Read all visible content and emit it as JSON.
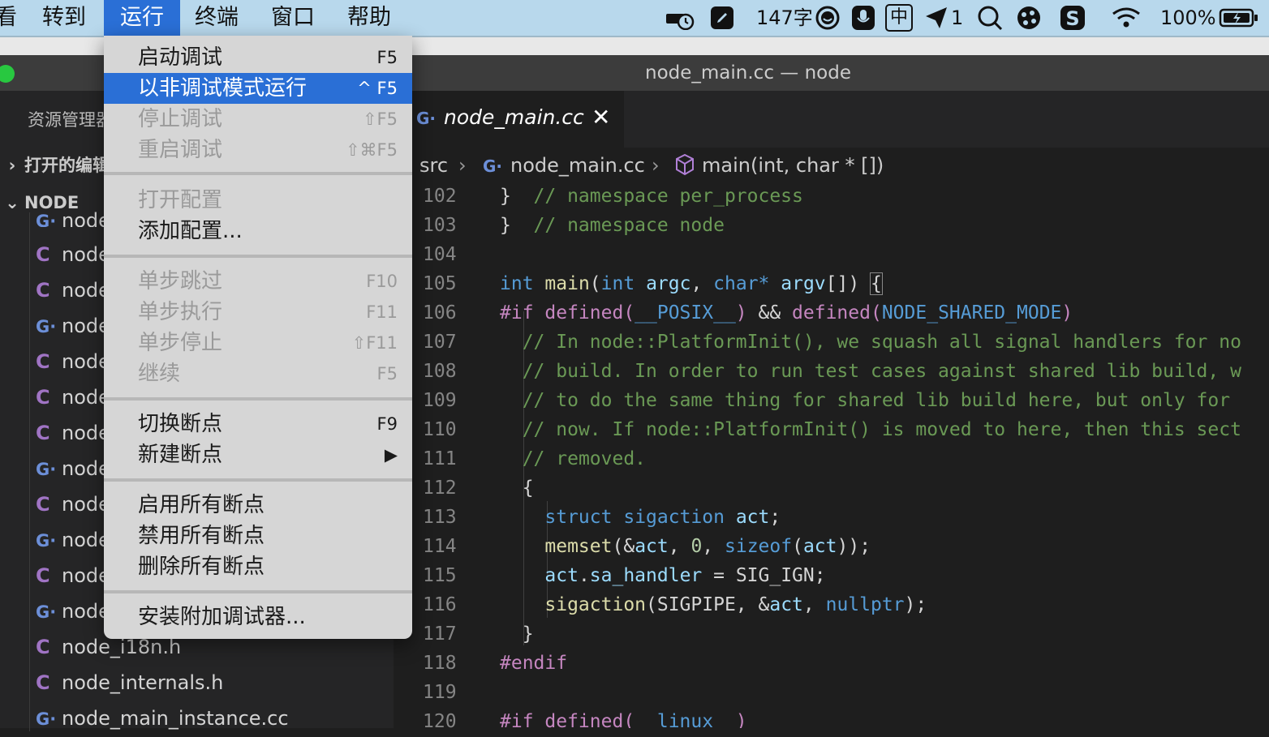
{
  "menubar": {
    "items": [
      "看",
      "转到",
      "运行",
      "终端",
      "窗口",
      "帮助"
    ],
    "char_count": "147字",
    "ime_label": "中",
    "notif_count": "1",
    "battery": "100%"
  },
  "window": {
    "title": "node_main.cc — node"
  },
  "sidebar": {
    "header": "资源管理器",
    "open_editors": "打开的编辑器",
    "project": "NODE",
    "files": [
      {
        "icon": "C",
        "name": "node_i18n.h"
      },
      {
        "icon": "C",
        "name": "node_internals.h"
      },
      {
        "icon": "C++",
        "name": "node_main_instance.cc"
      }
    ],
    "partial_name": "node"
  },
  "tab": {
    "name": "node_main.cc",
    "close": "✕"
  },
  "breadcrumb": {
    "folder": "src",
    "file": "node_main.cc",
    "symbol": "main(int, char * [])"
  },
  "run_menu": {
    "items": [
      {
        "label": "启动调试",
        "shortcut": "F5"
      },
      {
        "label": "以非调试模式运行",
        "shortcut": "^ F5"
      },
      {
        "label": "停止调试",
        "shortcut": "⇧F5"
      },
      {
        "label": "重启调试",
        "shortcut": "⇧⌘F5"
      },
      {
        "label": "打开配置",
        "shortcut": ""
      },
      {
        "label": "添加配置...",
        "shortcut": ""
      },
      {
        "label": "单步跳过",
        "shortcut": "F10"
      },
      {
        "label": "单步执行",
        "shortcut": "F11"
      },
      {
        "label": "单步停止",
        "shortcut": "⇧F11"
      },
      {
        "label": "继续",
        "shortcut": "F5"
      },
      {
        "label": "切换断点",
        "shortcut": "F9"
      },
      {
        "label": "新建断点",
        "shortcut": "▶"
      },
      {
        "label": "启用所有断点",
        "shortcut": ""
      },
      {
        "label": "禁用所有断点",
        "shortcut": ""
      },
      {
        "label": "删除所有断点",
        "shortcut": ""
      },
      {
        "label": "安装附加调试器...",
        "shortcut": ""
      }
    ]
  },
  "code": {
    "line_numbers": [
      "102",
      "103",
      "104",
      "105",
      "106",
      "107",
      "108",
      "109",
      "110",
      "111",
      "112",
      "113",
      "114",
      "115",
      "116",
      "117",
      "118",
      "119",
      "120"
    ],
    "comments": [
      "// namespace per_process",
      "// namespace node",
      "// In node::PlatformInit(), we squash all signal handlers for no",
      "// build. In order to run test cases against shared lib build, w",
      "// to do the same thing for shared lib build here, but only for",
      "// now. If node::PlatformInit() is moved to here, then this sect",
      "// removed."
    ]
  },
  "colors": {
    "accent": "#2a6fd6",
    "editor_bg": "#1e1e1e",
    "sidebar_bg": "#252526",
    "menubar_bg": "#b8d8ec"
  }
}
